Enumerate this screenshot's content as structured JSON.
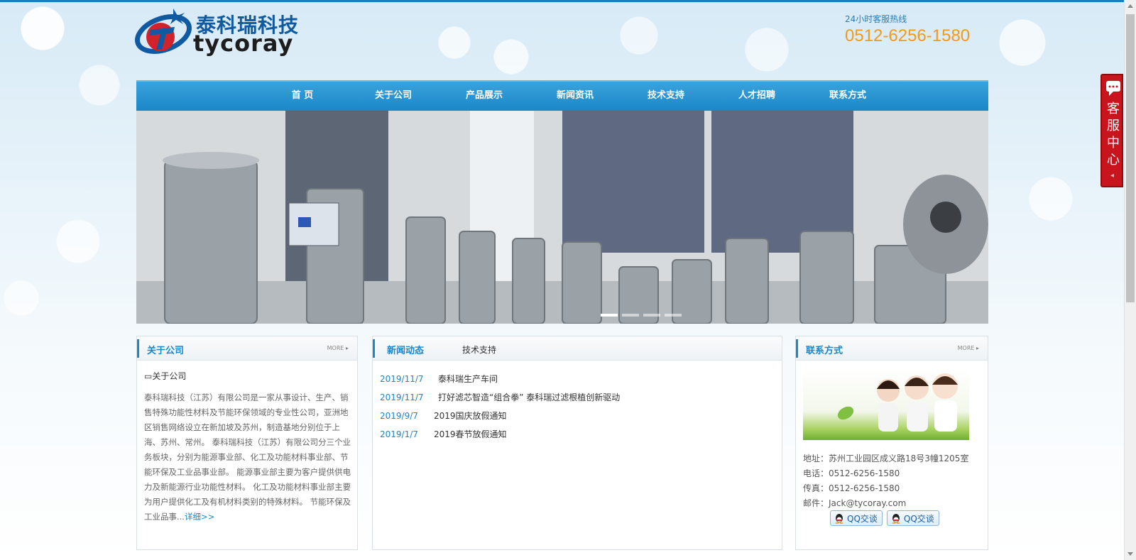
{
  "header": {
    "logo_cn": "泰科瑞科技",
    "logo_en": "tycoray",
    "hotline_label": "24小时客服热线",
    "hotline_number": "0512-6256-1580"
  },
  "nav": {
    "items": [
      "首 页",
      "关于公司",
      "产品展示",
      "新闻资讯",
      "技术支持",
      "人才招聘",
      "联系方式"
    ]
  },
  "banner": {
    "slides": 4,
    "active_slide": 1
  },
  "about": {
    "title": "关于公司",
    "more": "MORE",
    "image_alt": "关于公司",
    "text": "泰科瑞科技（江苏）有限公司是一家从事设计、生产、销售特殊功能性材料及节能环保领域的专业性公司，亚洲地区销售网络设立在新加坡及苏州，制造基地分别位于上海、苏州、常州。 泰科瑞科技（江苏）有限公司分三个业务板块，分别为能源事业部、化工及功能材料事业部、节能环保及工业品事业部。 能源事业部主要为客户提供供电力及新能源行业功能性材料。 化工及功能材料事业部主要为用户提供化工及有机材料类别的特殊材料。 节能环保及工业品事...",
    "detail_link": "详细>>"
  },
  "news": {
    "tab_active": "新闻动态",
    "tab_other": "技术支持",
    "items": [
      {
        "date": "2019/11/7",
        "title": "泰科瑞生产车间"
      },
      {
        "date": "2019/11/7",
        "title": "打好滤芯智造“组合拳” 泰科瑞过滤根植创新驱动"
      },
      {
        "date": "2019/9/7",
        "title": "2019国庆放假通知"
      },
      {
        "date": "2019/1/7",
        "title": "2019春节放假通知"
      }
    ]
  },
  "contact": {
    "title": "联系方式",
    "more": "MORE",
    "address": "地址：苏州工业园区成义路18号3幢1205室",
    "phone": "电话：0512-6256-1580",
    "fax": "传真：0512-6256-1580",
    "email": "邮件：Jack@tycoray.com",
    "qq_buttons": [
      "QQ交谈",
      "QQ交谈"
    ]
  },
  "service_float": {
    "label": "客服中心"
  },
  "colors": {
    "primary": "#1b87c8",
    "hotline": "#f39a1c",
    "service": "#c8141c"
  }
}
